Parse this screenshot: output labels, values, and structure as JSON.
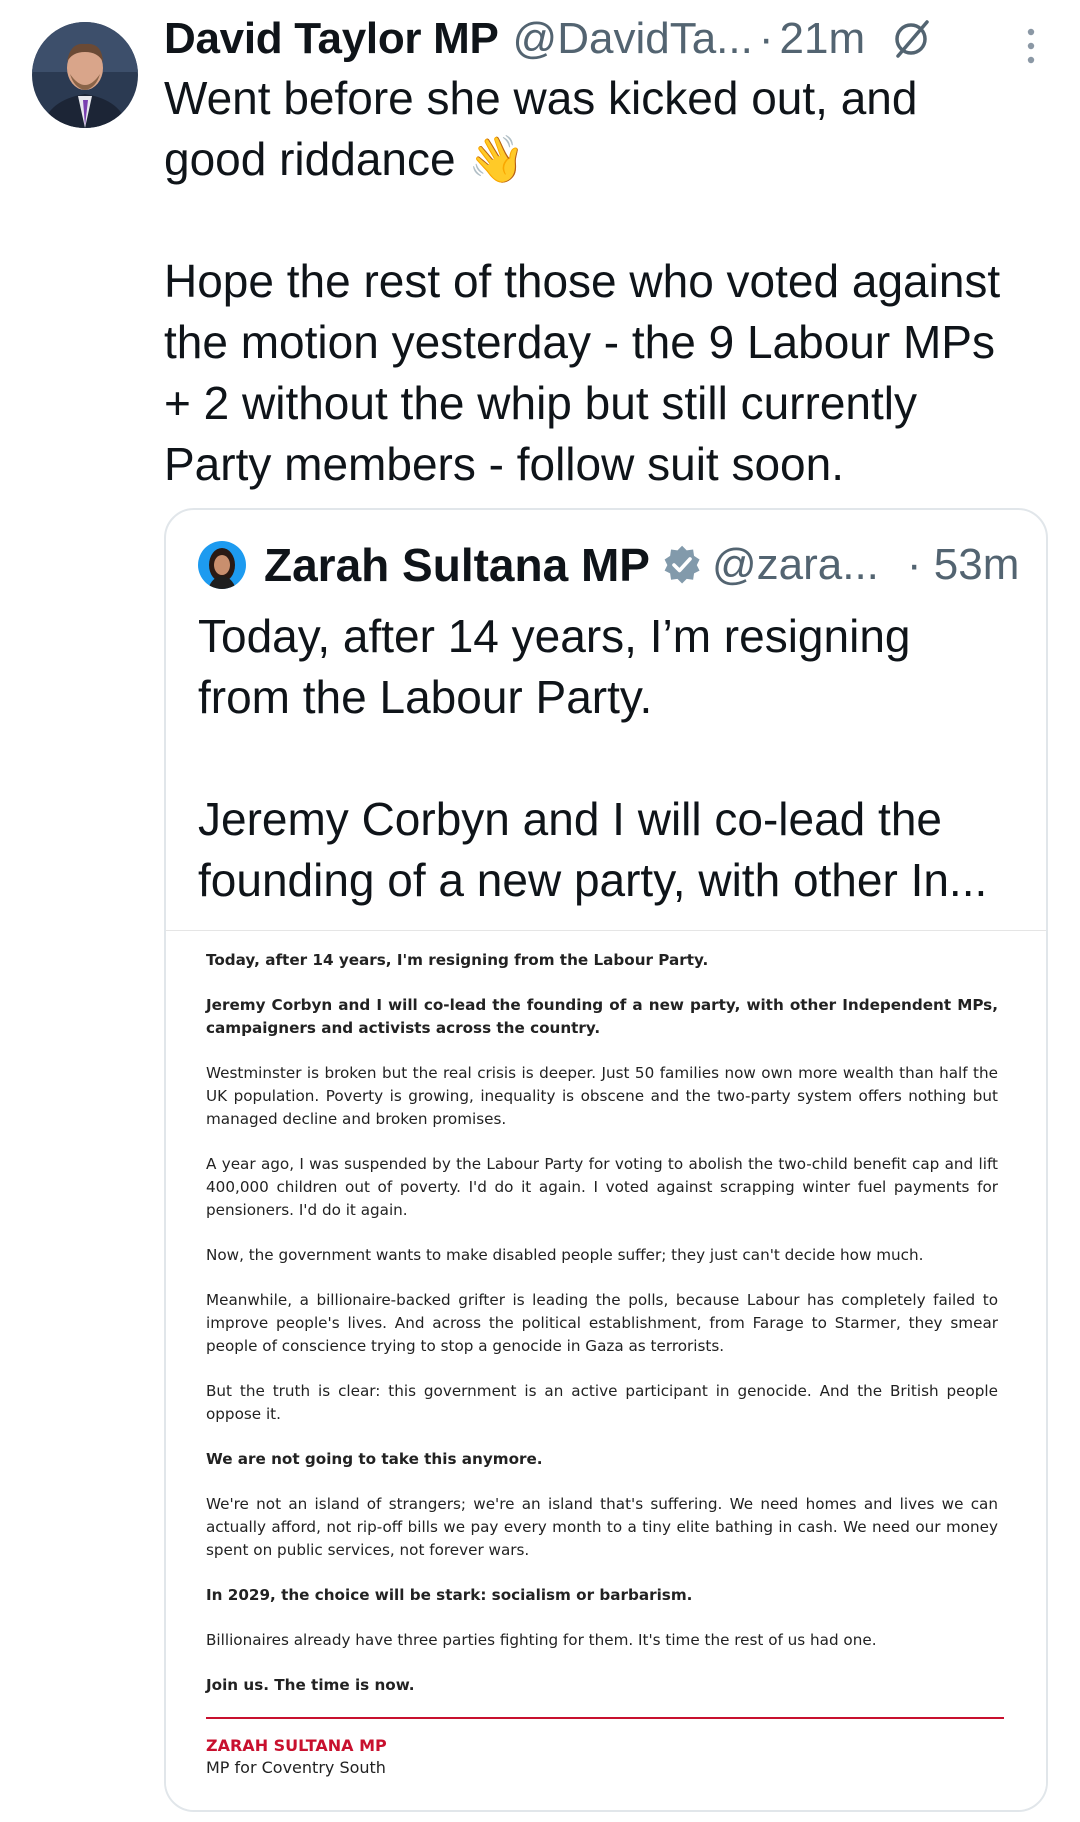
{
  "tweet": {
    "author_name": "David Taylor MP",
    "handle": "@DavidTa...",
    "separator": "·",
    "time": "21m",
    "text": "Went before she was kicked out, and\ngood riddance 👋\n\nHope the rest of those who voted against\nthe motion yesterday - the 9 Labour MPs\n+ 2 without the whip but still currently\nParty members - follow suit soon."
  },
  "quoted_tweet": {
    "author_name": "Zarah Sultana MP",
    "handle": "@zara...",
    "time": "· 53m",
    "text": "Today, after 14 years, I’m resigning\nfrom the Labour Party.\n\nJeremy Corbyn and I will co-lead the\nfounding of a new party, with other In..."
  },
  "letter": {
    "paragraphs": [
      "Today, after 14 years, I'm resigning from the Labour Party.",
      "Jeremy Corbyn and I will co-lead the founding of a new party, with other Independent MPs, campaigners and activists across the country.",
      "Westminster is broken but the real crisis is deeper. Just 50 families now own more wealth than half the UK population. Poverty is growing, inequality is obscene and the two-party system offers nothing but managed decline and broken promises.",
      "A year ago, I was suspended by the Labour Party for voting to abolish the two-child benefit cap and lift 400,000 children out of poverty. I'd do it again. I voted against scrapping winter fuel payments for pensioners. I'd do it again.",
      "Now, the government wants to make disabled people suffer; they just can't decide how much.",
      "Meanwhile, a billionaire-backed grifter is leading the polls, because Labour has completely failed to improve people's lives. And across the political establishment, from Farage to Starmer, they smear people of conscience trying to stop a genocide in Gaza as terrorists.",
      "But the truth is clear: this government is an active participant in genocide. And the British people oppose it.",
      "We are not going to take this anymore.",
      "We're not an island of strangers; we're an island that's suffering. We need homes and lives we can actually afford, not rip-off bills we pay every month to a tiny elite bathing in cash. We need our money spent on public services, not forever wars.",
      "In 2029, the choice will be stark: socialism or barbarism.",
      "Billionaires already have three parties fighting for them. It's time the rest of us had one.",
      "Join us. The time is now."
    ],
    "signature_name": "ZARAH SULTANA MP",
    "signature_role": "MP for Coventry South",
    "accent_color": "#c8102e"
  },
  "icons": {
    "grok": "grok-icon",
    "more": "more-icon",
    "verified": "verified-badge-icon"
  }
}
